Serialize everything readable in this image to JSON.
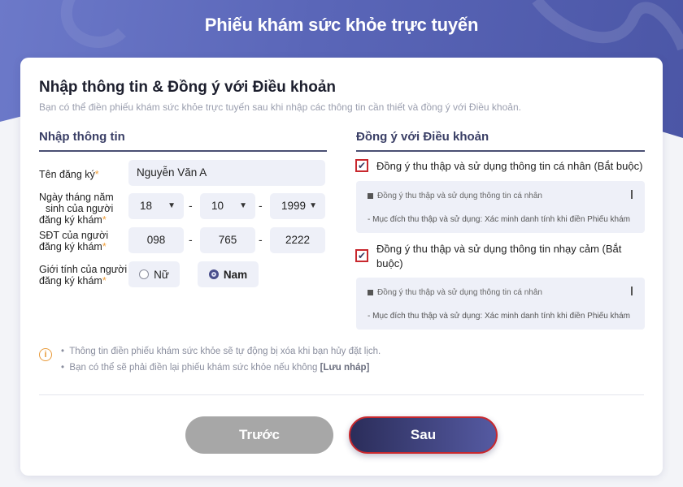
{
  "header": {
    "title": "Phiếu khám sức khỏe trực tuyến"
  },
  "card": {
    "title": "Nhập thông tin & Đồng ý với Điều khoản",
    "subtitle": "Bạn có thể điền phiếu khám sức khỏe trực tuyến sau khi nhập các thông tin cần thiết và đồng ý với Điều khoản."
  },
  "info_section": {
    "title": "Nhập thông tin",
    "name": {
      "label": "Tên đăng ký",
      "value": "Nguyễn Văn A"
    },
    "dob": {
      "label_line1": "Ngày tháng năm",
      "label_line2": "sinh của người",
      "label_line3": "đăng ký khám",
      "day": "18",
      "month": "10",
      "year": "1999"
    },
    "phone": {
      "label_line1": "SĐT của người",
      "label_line2": "đăng ký khám",
      "part1": "098",
      "part2": "765",
      "part3": "2222"
    },
    "gender": {
      "label_line1": "Giới tính của người",
      "label_line2": "đăng ký khám",
      "female": "Nữ",
      "male": "Nam",
      "selected": "Nam"
    },
    "required_mark": "*",
    "separator": "-"
  },
  "terms_section": {
    "title": "Đồng ý với Điều khoản",
    "items": [
      {
        "label": "Đồng ý thu thập và sử dụng thông tin cá nhân (Bắt buộc)",
        "checked": true,
        "text_title": "Đồng ý thu thập và sử dụng thông tin cá nhân",
        "text_body": "- Mục đích thu thập và sử dụng: Xác minh danh tính khi điền Phiếu khám"
      },
      {
        "label_line1": "Đồng ý thu thập và sử dụng thông tin nhạy cảm (Bắt",
        "label_line2": "buộc)",
        "checked": true,
        "text_title": "Đồng ý thu thập và sử dụng thông tin cá nhân",
        "text_body": "- Mục đích thu thập và sử dụng: Xác minh danh tính khi điền Phiếu khám"
      }
    ]
  },
  "notes": {
    "icon": "info-icon",
    "line1": "Thông tin điền phiếu khám sức khỏe sẽ tự động bị xóa khi bạn hủy đặt lịch.",
    "line2_prefix": "Bạn có thể sẽ phải điền lại phiếu khám sức khỏe nếu không",
    "line2_bold": "[Lưu nháp]"
  },
  "buttons": {
    "prev": "Trước",
    "next": "Sau"
  },
  "colors": {
    "accent": "#4a4f8c",
    "required": "#f0a03c",
    "check_border": "#c8282e"
  }
}
